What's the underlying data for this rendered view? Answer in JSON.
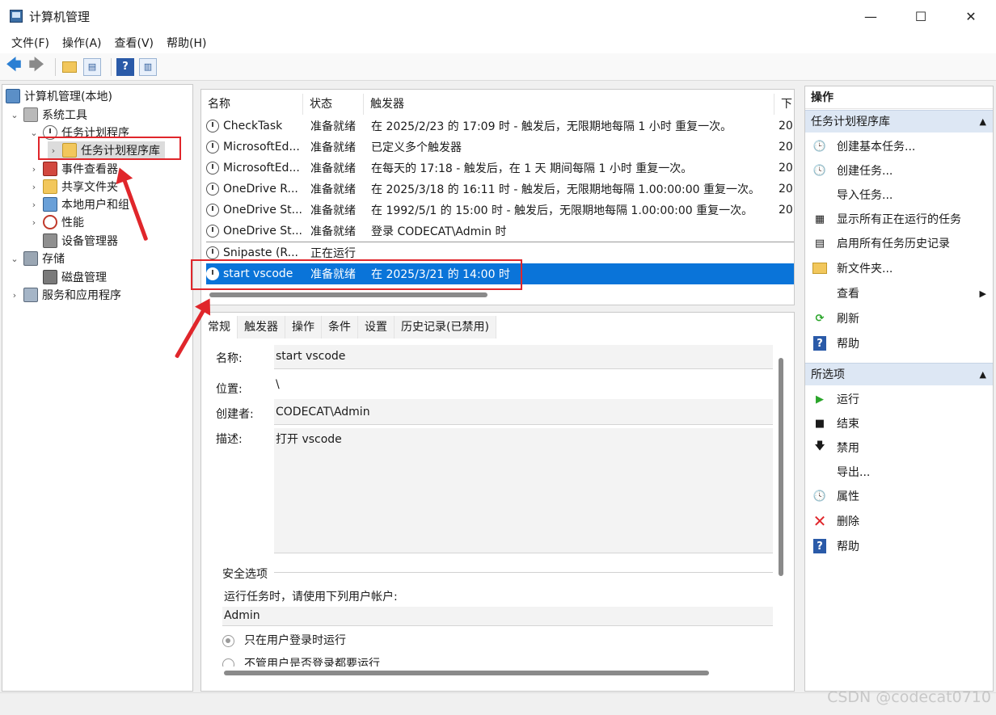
{
  "window": {
    "title": "计算机管理",
    "minimize": "—",
    "maximize": "☐",
    "close": "✕"
  },
  "menu": [
    "文件(F)",
    "操作(A)",
    "查看(V)",
    "帮助(H)"
  ],
  "toolbar": {
    "back": "🡄",
    "forward": "🡆",
    "help": "?"
  },
  "tree": {
    "root": "计算机管理(本地)",
    "system_tools": "系统工具",
    "task_scheduler": "任务计划程序",
    "task_library": "任务计划程序库",
    "event_viewer": "事件查看器",
    "shared_folders": "共享文件夹",
    "local_users": "本地用户和组",
    "performance": "性能",
    "device_manager": "设备管理器",
    "storage": "存储",
    "disk_management": "磁盘管理",
    "services": "服务和应用程序"
  },
  "task_table": {
    "headers": [
      "名称",
      "状态",
      "触发器",
      "下"
    ],
    "rows": [
      {
        "name": "CheckTask",
        "status": "准备就绪",
        "trigger": "在 2025/2/23 的 17:09 时 - 触发后，无限期地每隔 1 小时 重复一次。",
        "next": "20"
      },
      {
        "name": "MicrosoftEd...",
        "status": "准备就绪",
        "trigger": "已定义多个触发器",
        "next": "20"
      },
      {
        "name": "MicrosoftEd...",
        "status": "准备就绪",
        "trigger": "在每天的 17:18 - 触发后，在 1 天 期间每隔 1 小时 重复一次。",
        "next": "20"
      },
      {
        "name": "OneDrive R...",
        "status": "准备就绪",
        "trigger": "在 2025/3/18 的 16:11 时 - 触发后，无限期地每隔 1.00:00:00 重复一次。",
        "next": "20"
      },
      {
        "name": "OneDrive St...",
        "status": "准备就绪",
        "trigger": "在 1992/5/1 的 15:00 时 - 触发后，无限期地每隔 1.00:00:00 重复一次。",
        "next": "20"
      },
      {
        "name": "OneDrive St...",
        "status": "准备就绪",
        "trigger": "登录 CODECAT\\Admin 时",
        "next": ""
      },
      {
        "name": "Snipaste (R...",
        "status": "正在运行",
        "trigger": "",
        "next": ""
      },
      {
        "name": "start vscode",
        "status": "准备就绪",
        "trigger": "在 2025/3/21 的 14:00 时",
        "next": ""
      }
    ]
  },
  "detail_tabs": [
    "常规",
    "触发器",
    "操作",
    "条件",
    "设置",
    "历史记录(已禁用)"
  ],
  "general": {
    "name_label": "名称:",
    "name_value": "start vscode",
    "location_label": "位置:",
    "location_value": "\\",
    "author_label": "创建者:",
    "author_value": "CODECAT\\Admin",
    "desc_label": "描述:",
    "desc_value": "打开 vscode",
    "security_title": "安全选项",
    "run_as_text": "运行任务时，请使用下列用户帐户:",
    "account": "Admin",
    "radio1": "只在用户登录时运行",
    "radio2": "不管用户是否登录都要运行"
  },
  "actions": {
    "header": "操作",
    "group1": "任务计划程序库",
    "group1_items": [
      "创建基本任务...",
      "创建任务...",
      "导入任务...",
      "显示所有正在运行的任务",
      "启用所有任务历史记录",
      "新文件夹...",
      "查看",
      "刷新",
      "帮助"
    ],
    "group2": "所选项",
    "group2_items": [
      "运行",
      "结束",
      "禁用",
      "导出...",
      "属性",
      "删除",
      "帮助"
    ]
  },
  "watermark": "CSDN @codecat0710",
  "colors": {
    "selection": "#0a74d9",
    "annotation_red": "#e0262b",
    "group_header": "#dde7f4"
  }
}
